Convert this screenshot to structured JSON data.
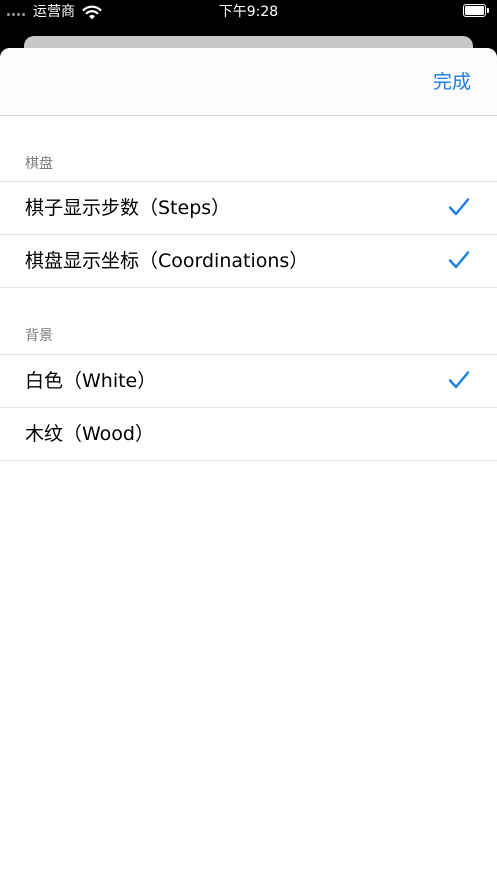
{
  "status_bar": {
    "carrier": "运营商",
    "time": "下午9:28"
  },
  "nav": {
    "done_label": "完成"
  },
  "sections": [
    {
      "header": "棋盘",
      "rows": [
        {
          "label": "棋子显示步数（Steps）",
          "checked": true
        },
        {
          "label": "棋盘显示坐标（Coordinations）",
          "checked": true
        }
      ]
    },
    {
      "header": "背景",
      "rows": [
        {
          "label": "白色（White）",
          "checked": true
        },
        {
          "label": "木纹（Wood）",
          "checked": false
        }
      ]
    }
  ],
  "colors": {
    "accent": "#1a7ee8",
    "separator": "#e2e2e2",
    "section_header_text": "#7c7c7c"
  }
}
